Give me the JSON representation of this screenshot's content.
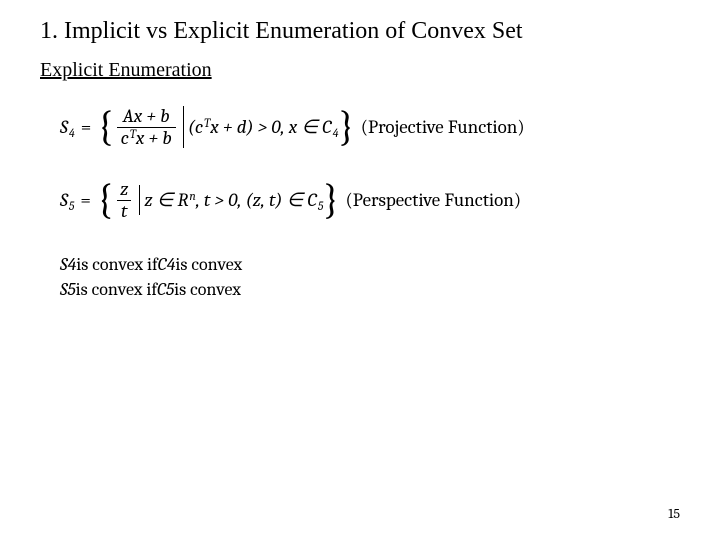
{
  "title": "1. Implicit vs Explicit Enumeration of Convex Set",
  "subtitle": "Explicit Enumeration",
  "eq4": {
    "Svar": "S",
    "Ssub": "4",
    "frac_num": "Ax + b",
    "frac_den_pre": "c",
    "frac_den_sup": "T",
    "frac_den_tail": "x + b",
    "cond_open": "(c",
    "cond_sup": "T",
    "cond_mid": "x + d) > 0, x ∈ C",
    "cond_sub": "4",
    "annotation": "(Projective Function)"
  },
  "eq5": {
    "Svar": "S",
    "Ssub": "5",
    "frac_num": "z",
    "frac_den": "t",
    "cond_pre": "z ∈ R",
    "cond_sup": "n",
    "cond_mid": ", t > 0, (z, t) ∈ C",
    "cond_sub": "5",
    "annotation": "(Perspective Function)"
  },
  "remark1": {
    "S": "S",
    "Ssub": "4",
    "mid": " is convex if ",
    "C": "C",
    "Csub": "4",
    "tail": " is convex"
  },
  "remark2": {
    "S": "S",
    "Ssub": "5",
    "mid": " is convex if ",
    "C": "C",
    "Csub": "5",
    "tail": " is convex"
  },
  "page_num": "15"
}
